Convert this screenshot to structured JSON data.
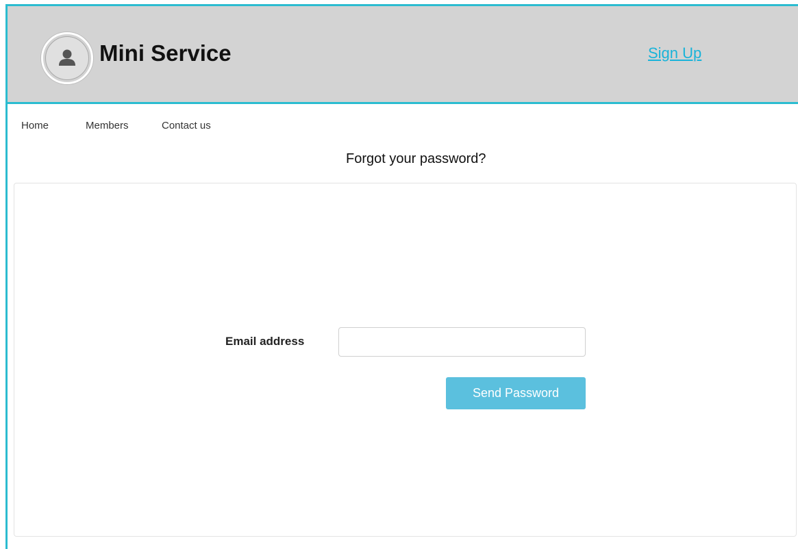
{
  "header": {
    "title": "Mini Service",
    "signup_label": "Sign Up",
    "logo_icon": "user-icon"
  },
  "nav": {
    "items": [
      {
        "label": "Home"
      },
      {
        "label": "Members"
      },
      {
        "label": "Contact us"
      }
    ]
  },
  "main": {
    "heading": "Forgot your password?",
    "form": {
      "email_label": "Email address",
      "email_value": "",
      "email_placeholder": "",
      "submit_label": "Send Password"
    }
  },
  "colors": {
    "accent": "#2bbcd0",
    "header_bg": "#d3d3d3",
    "link": "#19b3d9",
    "button_bg": "#5bc0de"
  }
}
